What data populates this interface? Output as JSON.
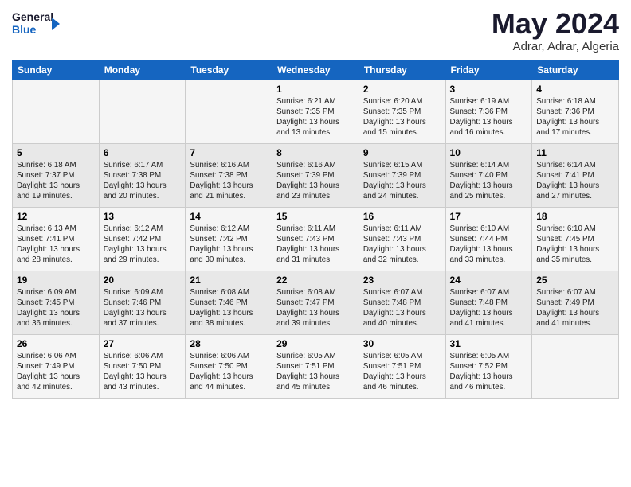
{
  "header": {
    "logo_line1": "General",
    "logo_line2": "Blue",
    "month": "May 2024",
    "location": "Adrar, Adrar, Algeria"
  },
  "days_of_week": [
    "Sunday",
    "Monday",
    "Tuesday",
    "Wednesday",
    "Thursday",
    "Friday",
    "Saturday"
  ],
  "weeks": [
    [
      {
        "day": "",
        "info": ""
      },
      {
        "day": "",
        "info": ""
      },
      {
        "day": "",
        "info": ""
      },
      {
        "day": "1",
        "info": "Sunrise: 6:21 AM\nSunset: 7:35 PM\nDaylight: 13 hours and 13 minutes."
      },
      {
        "day": "2",
        "info": "Sunrise: 6:20 AM\nSunset: 7:35 PM\nDaylight: 13 hours and 15 minutes."
      },
      {
        "day": "3",
        "info": "Sunrise: 6:19 AM\nSunset: 7:36 PM\nDaylight: 13 hours and 16 minutes."
      },
      {
        "day": "4",
        "info": "Sunrise: 6:18 AM\nSunset: 7:36 PM\nDaylight: 13 hours and 17 minutes."
      }
    ],
    [
      {
        "day": "5",
        "info": "Sunrise: 6:18 AM\nSunset: 7:37 PM\nDaylight: 13 hours and 19 minutes."
      },
      {
        "day": "6",
        "info": "Sunrise: 6:17 AM\nSunset: 7:38 PM\nDaylight: 13 hours and 20 minutes."
      },
      {
        "day": "7",
        "info": "Sunrise: 6:16 AM\nSunset: 7:38 PM\nDaylight: 13 hours and 21 minutes."
      },
      {
        "day": "8",
        "info": "Sunrise: 6:16 AM\nSunset: 7:39 PM\nDaylight: 13 hours and 23 minutes."
      },
      {
        "day": "9",
        "info": "Sunrise: 6:15 AM\nSunset: 7:39 PM\nDaylight: 13 hours and 24 minutes."
      },
      {
        "day": "10",
        "info": "Sunrise: 6:14 AM\nSunset: 7:40 PM\nDaylight: 13 hours and 25 minutes."
      },
      {
        "day": "11",
        "info": "Sunrise: 6:14 AM\nSunset: 7:41 PM\nDaylight: 13 hours and 27 minutes."
      }
    ],
    [
      {
        "day": "12",
        "info": "Sunrise: 6:13 AM\nSunset: 7:41 PM\nDaylight: 13 hours and 28 minutes."
      },
      {
        "day": "13",
        "info": "Sunrise: 6:12 AM\nSunset: 7:42 PM\nDaylight: 13 hours and 29 minutes."
      },
      {
        "day": "14",
        "info": "Sunrise: 6:12 AM\nSunset: 7:42 PM\nDaylight: 13 hours and 30 minutes."
      },
      {
        "day": "15",
        "info": "Sunrise: 6:11 AM\nSunset: 7:43 PM\nDaylight: 13 hours and 31 minutes."
      },
      {
        "day": "16",
        "info": "Sunrise: 6:11 AM\nSunset: 7:43 PM\nDaylight: 13 hours and 32 minutes."
      },
      {
        "day": "17",
        "info": "Sunrise: 6:10 AM\nSunset: 7:44 PM\nDaylight: 13 hours and 33 minutes."
      },
      {
        "day": "18",
        "info": "Sunrise: 6:10 AM\nSunset: 7:45 PM\nDaylight: 13 hours and 35 minutes."
      }
    ],
    [
      {
        "day": "19",
        "info": "Sunrise: 6:09 AM\nSunset: 7:45 PM\nDaylight: 13 hours and 36 minutes."
      },
      {
        "day": "20",
        "info": "Sunrise: 6:09 AM\nSunset: 7:46 PM\nDaylight: 13 hours and 37 minutes."
      },
      {
        "day": "21",
        "info": "Sunrise: 6:08 AM\nSunset: 7:46 PM\nDaylight: 13 hours and 38 minutes."
      },
      {
        "day": "22",
        "info": "Sunrise: 6:08 AM\nSunset: 7:47 PM\nDaylight: 13 hours and 39 minutes."
      },
      {
        "day": "23",
        "info": "Sunrise: 6:07 AM\nSunset: 7:48 PM\nDaylight: 13 hours and 40 minutes."
      },
      {
        "day": "24",
        "info": "Sunrise: 6:07 AM\nSunset: 7:48 PM\nDaylight: 13 hours and 41 minutes."
      },
      {
        "day": "25",
        "info": "Sunrise: 6:07 AM\nSunset: 7:49 PM\nDaylight: 13 hours and 41 minutes."
      }
    ],
    [
      {
        "day": "26",
        "info": "Sunrise: 6:06 AM\nSunset: 7:49 PM\nDaylight: 13 hours and 42 minutes."
      },
      {
        "day": "27",
        "info": "Sunrise: 6:06 AM\nSunset: 7:50 PM\nDaylight: 13 hours and 43 minutes."
      },
      {
        "day": "28",
        "info": "Sunrise: 6:06 AM\nSunset: 7:50 PM\nDaylight: 13 hours and 44 minutes."
      },
      {
        "day": "29",
        "info": "Sunrise: 6:05 AM\nSunset: 7:51 PM\nDaylight: 13 hours and 45 minutes."
      },
      {
        "day": "30",
        "info": "Sunrise: 6:05 AM\nSunset: 7:51 PM\nDaylight: 13 hours and 46 minutes."
      },
      {
        "day": "31",
        "info": "Sunrise: 6:05 AM\nSunset: 7:52 PM\nDaylight: 13 hours and 46 minutes."
      },
      {
        "day": "",
        "info": ""
      }
    ]
  ]
}
